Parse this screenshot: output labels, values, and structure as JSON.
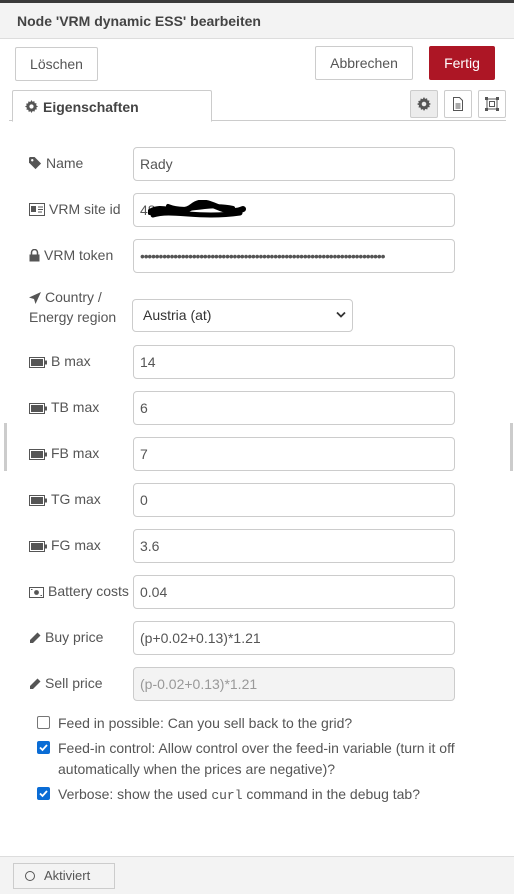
{
  "header": {
    "title": "Node 'VRM dynamic ESS' bearbeiten",
    "delete_label": "Löschen",
    "cancel_label": "Abbrechen",
    "done_label": "Fertig"
  },
  "tabs": {
    "properties_label": "Eigenschaften"
  },
  "fields": {
    "name": {
      "label": "Name",
      "value": "Rady"
    },
    "site_id": {
      "label": "VRM site id",
      "value": "48"
    },
    "token": {
      "label": "VRM token",
      "value": "••••••••••••••••••••••••••••••••••••••••••••••••••••••••••••••••••"
    },
    "country": {
      "label_line1": "Country /",
      "label_line2": "Energy region",
      "value": "Austria (at)"
    },
    "b_max": {
      "label": "B max",
      "value": "14"
    },
    "tb_max": {
      "label": "TB max",
      "value": "6"
    },
    "fb_max": {
      "label": "FB max",
      "value": "7"
    },
    "tg_max": {
      "label": "TG max",
      "value": "0"
    },
    "fg_max": {
      "label": "FG max",
      "value": "3.6"
    },
    "battery_costs": {
      "label": "Battery costs",
      "value": "0.04"
    },
    "buy_price": {
      "label": "Buy price",
      "value": "(p+0.02+0.13)*1.21"
    },
    "sell_price": {
      "label": "Sell price",
      "value": "(p-0.02+0.13)*1.21"
    }
  },
  "checks": {
    "feed_in_possible": {
      "label": "Feed in possible: Can you sell back to the grid?",
      "checked": false
    },
    "feed_in_control": {
      "label": "Feed-in control: Allow control over the feed-in variable (turn it off automatically when the prices are negative)?",
      "checked": true
    },
    "verbose": {
      "label_pre": "Verbose: show the used ",
      "label_code": "curl",
      "label_post": " command in the debug tab?",
      "checked": true
    }
  },
  "footer": {
    "enabled_label": "Aktiviert"
  },
  "colors": {
    "accent": "#ad1625",
    "checkbox": "#0a6cd5",
    "header_bg": "#f3f3f3"
  }
}
